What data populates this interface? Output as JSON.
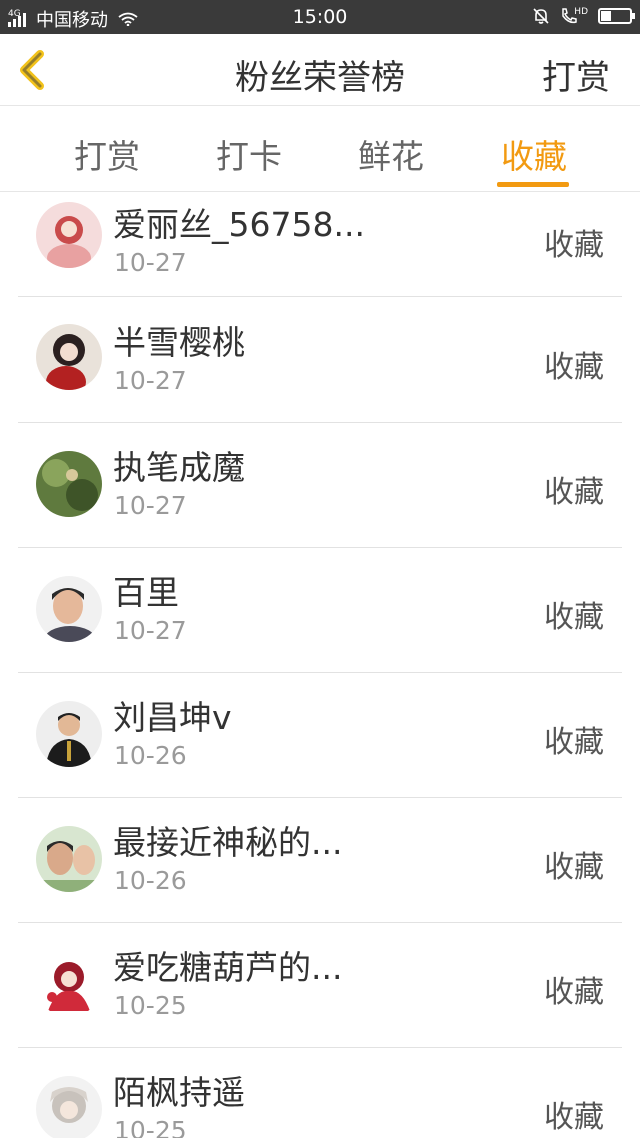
{
  "status_bar": {
    "network": "4G",
    "carrier": "中国移动",
    "time": "15:00",
    "hd_label": "HD",
    "battery_level": 0.35
  },
  "header": {
    "title": "粉丝荣誉榜",
    "action_label": "打赏"
  },
  "tabs": [
    {
      "label": "打赏",
      "active": false
    },
    {
      "label": "打卡",
      "active": false
    },
    {
      "label": "鲜花",
      "active": false
    },
    {
      "label": "收藏",
      "active": true
    }
  ],
  "list": {
    "items": [
      {
        "name": "爱丽丝_56758...",
        "date": "10-27",
        "action": "收藏"
      },
      {
        "name": "半雪樱桃",
        "date": "10-27",
        "action": "收藏"
      },
      {
        "name": "执笔成魔",
        "date": "10-27",
        "action": "收藏"
      },
      {
        "name": "百里",
        "date": "10-27",
        "action": "收藏"
      },
      {
        "name": "刘昌坤v",
        "date": "10-26",
        "action": "收藏"
      },
      {
        "name": "最接近神秘的...",
        "date": "10-26",
        "action": "收藏"
      },
      {
        "name": "爱吃糖葫芦的...",
        "date": "10-25",
        "action": "收藏"
      },
      {
        "name": "陌枫持遥",
        "date": "10-25",
        "action": "收藏"
      }
    ]
  },
  "colors": {
    "accent": "#f29a11",
    "back_arrow": "#f2c21a",
    "status_bar": "#3a3a3a"
  }
}
